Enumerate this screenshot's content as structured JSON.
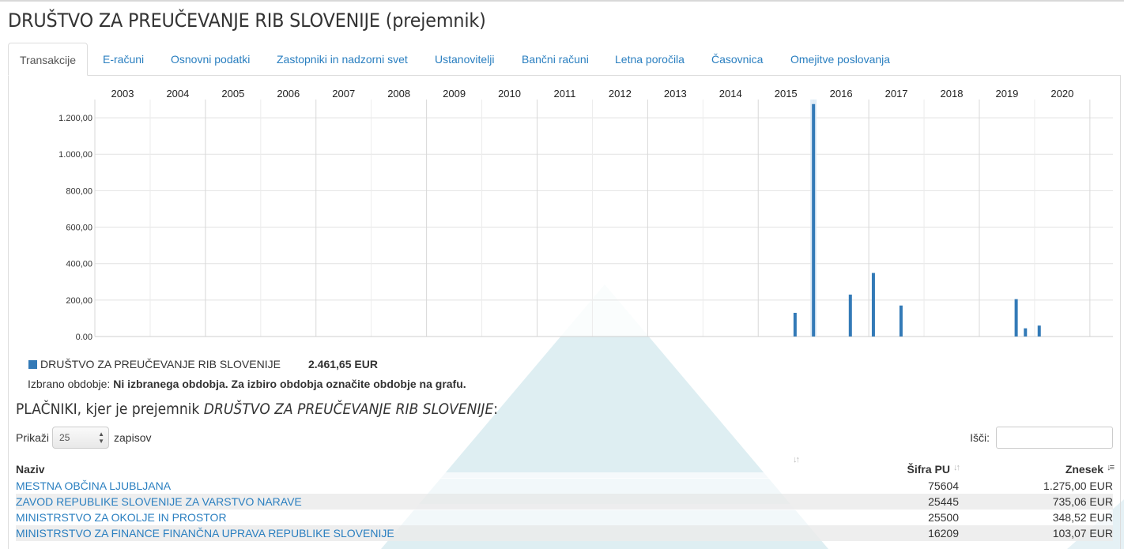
{
  "page": {
    "title": "DRUŠTVO ZA PREUČEVANJE RIB SLOVENIJE (prejemnik)"
  },
  "tabs": [
    {
      "label": "Transakcije",
      "active": true
    },
    {
      "label": "E-računi"
    },
    {
      "label": "Osnovni podatki"
    },
    {
      "label": "Zastopniki in nadzorni svet"
    },
    {
      "label": "Ustanovitelji"
    },
    {
      "label": "Bančni računi"
    },
    {
      "label": "Letna poročila"
    },
    {
      "label": "Časovnica"
    },
    {
      "label": "Omejitve poslovanja"
    }
  ],
  "chart_data": {
    "type": "bar",
    "x_ticks": [
      "2003",
      "2004",
      "2005",
      "2006",
      "2007",
      "2008",
      "2009",
      "2010",
      "2011",
      "2012",
      "2013",
      "2014",
      "2015",
      "2016",
      "2017",
      "2018",
      "2019",
      "2020"
    ],
    "y_ticks": [
      "0.00",
      "200,00",
      "400,00",
      "600,00",
      "800,00",
      "1.000,00",
      "1.200,00"
    ],
    "ylim": [
      0,
      1300
    ],
    "xlim": [
      "2002-07",
      "2020-12"
    ],
    "series": [
      {
        "name": "DRUŠTVO ZA PREUČEVANJE RIB SLOVENIJE",
        "color": "#337ab7",
        "points": [
          {
            "date": "2015-03",
            "value": 130
          },
          {
            "date": "2015-07",
            "value": 1275
          },
          {
            "date": "2016-03",
            "value": 230
          },
          {
            "date": "2016-08",
            "value": 348.52
          },
          {
            "date": "2017-02",
            "value": 170
          },
          {
            "date": "2019-03",
            "value": 205
          },
          {
            "date": "2019-05",
            "value": 45
          },
          {
            "date": "2019-08",
            "value": 60
          }
        ]
      }
    ],
    "grid": true,
    "selected_highlight": "2015-07"
  },
  "legend": {
    "name": "DRUŠTVO ZA PREUČEVANJE RIB SLOVENIJE",
    "total": "2.461,65 EUR"
  },
  "period": {
    "label": "Izbrano obdobje:",
    "value": "Ni izbranega obdobja. Za izbiro obdobja označite obdobje na grafu."
  },
  "section": {
    "title_prefix": "PLAČNIKI, kjer je prejemnik",
    "title_entity": "DRUŠTVO ZA PREUČEVANJE RIB SLOVENIJE",
    "title_suffix": ":"
  },
  "length_control": {
    "prefix": "Prikaži",
    "value": "25",
    "suffix": "zapisov"
  },
  "search": {
    "label": "Išči:",
    "value": ""
  },
  "table": {
    "headers": {
      "name": "Naziv",
      "code": "Šifra PU",
      "amount": "Znesek"
    },
    "rows": [
      {
        "name": "MESTNA OBČINA LJUBLJANA",
        "code": "75604",
        "amount": "1.275,00 EUR"
      },
      {
        "name": "ZAVOD REPUBLIKE SLOVENIJE ZA VARSTVO NARAVE",
        "code": "25445",
        "amount": "735,06 EUR"
      },
      {
        "name": "MINISTRSTVO ZA OKOLJE IN PROSTOR",
        "code": "25500",
        "amount": "348,52 EUR"
      },
      {
        "name": "MINISTRSTVO ZA FINANCE FINANČNA UPRAVA REPUBLIKE SLOVENIJE",
        "code": "16209",
        "amount": "103,07 EUR"
      }
    ]
  }
}
